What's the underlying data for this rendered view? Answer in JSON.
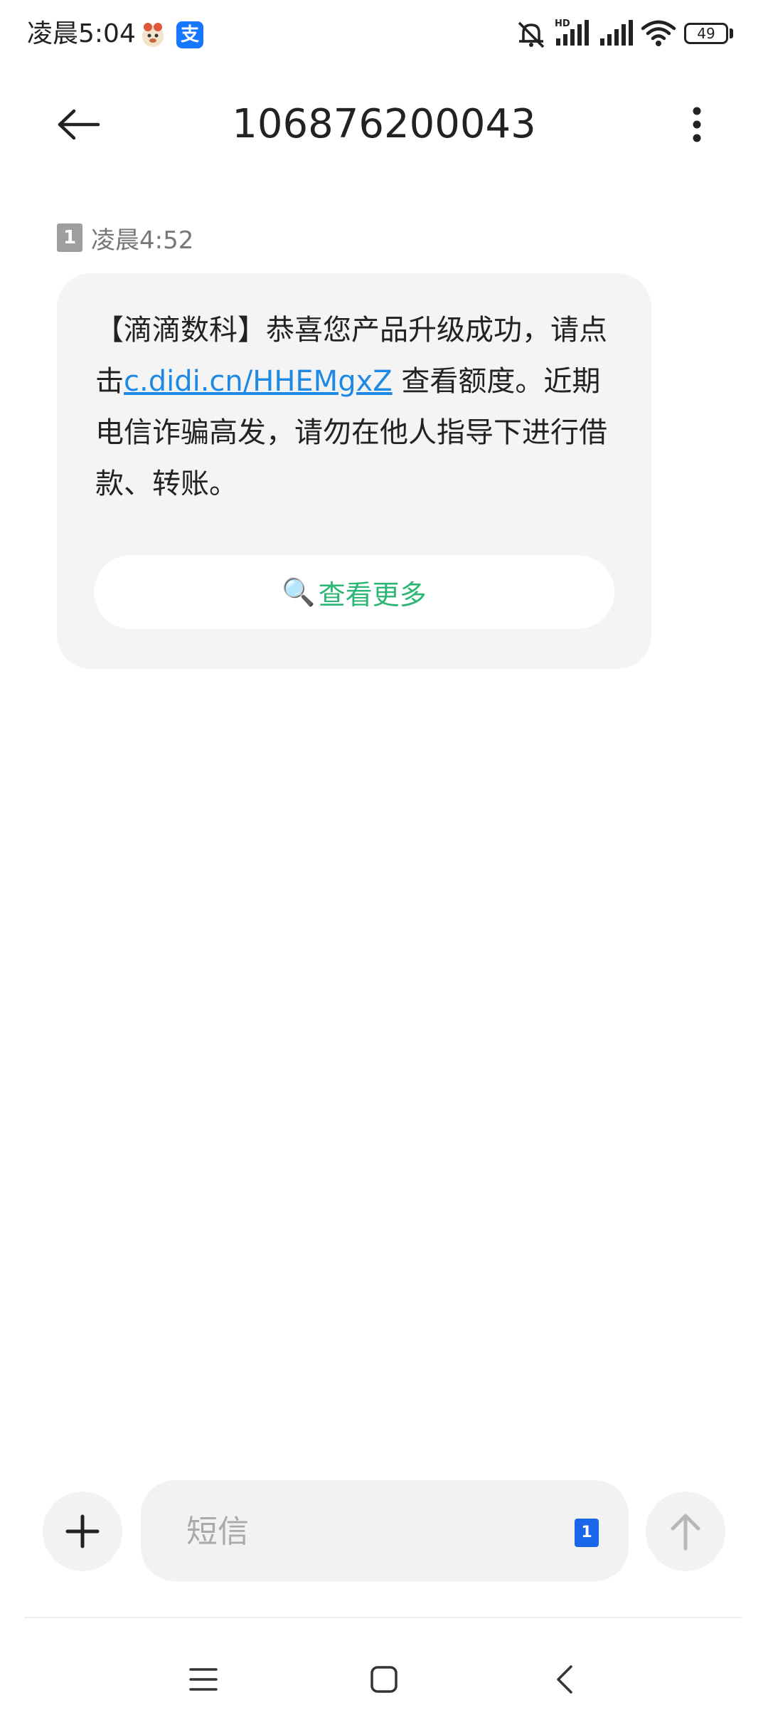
{
  "status_bar": {
    "time": "凌晨5:04",
    "app_icon_2_glyph": "支",
    "battery": "49",
    "hd_label": "HD"
  },
  "header": {
    "title": "106876200043"
  },
  "message": {
    "sim_slot": "1",
    "time": "凌晨4:52",
    "text_before_link": "【滴滴数科】恭喜您产品升级成功，请点击",
    "link": "c.didi.cn/HHEMgxZ",
    "text_after_link": " 查看额度。近期电信诈骗高发，请勿在他人指导下进行借款、转账。",
    "view_more_icon": "🔍",
    "view_more_label": "查看更多"
  },
  "compose": {
    "placeholder": "短信",
    "sim_slot": "1"
  },
  "colors": {
    "link": "#1e88e5",
    "view_more": "#2bb673",
    "sim_button": "#1a66e8",
    "bubble": "#f4f4f4"
  },
  "icons": {
    "back": "arrow-left-icon",
    "more": "more-vertical-icon",
    "plus": "plus-icon",
    "send": "arrow-up-icon",
    "nav_menu": "menu-icon",
    "nav_home": "square-icon",
    "nav_back": "chevron-left-icon"
  }
}
